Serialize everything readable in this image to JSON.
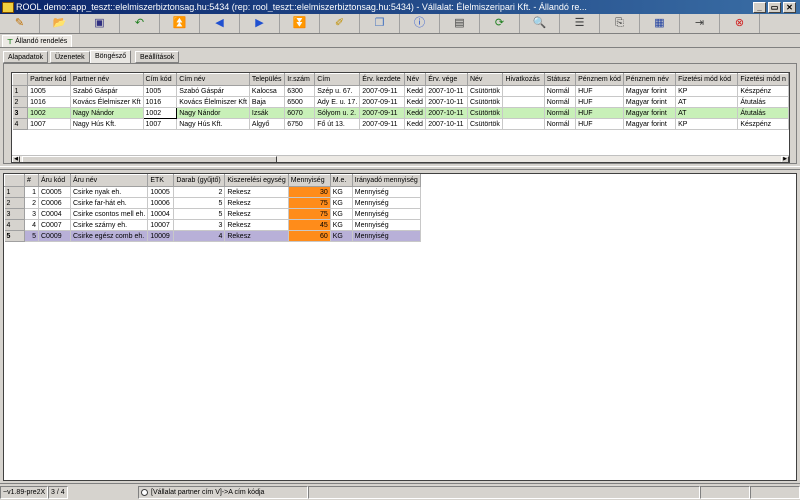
{
  "window": {
    "title": "ROOL demo::app_teszt::elelmiszerbiztonsag.hu:5434 (rep: rool_teszt::elelmiszerbiztonsag.hu:5434) - Vállalat: Élelmiszeripari Kft. - Állandó re...",
    "minimize": "_",
    "restore": "▭",
    "close": "✕"
  },
  "toolbar": [
    {
      "icon": "edit-icon",
      "glyph": "✎",
      "color": "#c07000"
    },
    {
      "icon": "open-icon",
      "glyph": "📂",
      "color": "#3060c0"
    },
    {
      "icon": "save-icon",
      "glyph": "▣",
      "color": "#303080"
    },
    {
      "icon": "undo-icon",
      "glyph": "↶",
      "color": "#208020"
    },
    {
      "icon": "first-icon",
      "glyph": "⏫",
      "color": "#2050d0"
    },
    {
      "icon": "prev-icon",
      "glyph": "◀",
      "color": "#2050d0"
    },
    {
      "icon": "next-icon",
      "glyph": "▶",
      "color": "#2050d0"
    },
    {
      "icon": "last-icon",
      "glyph": "⏬",
      "color": "#2050d0"
    },
    {
      "icon": "note-icon",
      "glyph": "✐",
      "color": "#c09000"
    },
    {
      "icon": "copy-icon",
      "glyph": "❐",
      "color": "#4070c0"
    },
    {
      "icon": "info-icon",
      "glyph": "ⓘ",
      "color": "#2050d0"
    },
    {
      "icon": "window-icon",
      "glyph": "▤",
      "color": "#404040"
    },
    {
      "icon": "refresh-icon",
      "glyph": "⟳",
      "color": "#208020"
    },
    {
      "icon": "search-icon",
      "glyph": "🔍",
      "color": "#404040"
    },
    {
      "icon": "layout-icon",
      "glyph": "☰",
      "color": "#404040"
    },
    {
      "icon": "export-icon",
      "glyph": "⎘",
      "color": "#404040"
    },
    {
      "icon": "grid-icon",
      "glyph": "▦",
      "color": "#2040a0"
    },
    {
      "icon": "exit-icon",
      "glyph": "⇥",
      "color": "#404040"
    },
    {
      "icon": "stop-icon",
      "glyph": "⊗",
      "color": "#d02020"
    }
  ],
  "window_tab": {
    "label": "Állandó rendelés"
  },
  "tabs": [
    {
      "label": "Alapadatok"
    },
    {
      "label": "Üzenetek"
    },
    {
      "label": "Böngésző"
    },
    {
      "label": "Beállítások"
    }
  ],
  "partner_grid": {
    "columns": [
      "",
      "Partner kód",
      "Partner név",
      "Cím kód",
      "Cím név",
      "Település",
      "Ir.szám",
      "Cím",
      "Érv. kezdete",
      "Név",
      "Érv. vége",
      "Név",
      "Hivatkozás",
      "Státusz",
      "Pénznem kód",
      "Pénznem név",
      "Fizetési mód kód",
      "Fizetési mód n"
    ],
    "rows": [
      [
        "1",
        "1005",
        "Szabó Gáspár",
        "1005",
        "Szabó Gáspár",
        "Kalocsa",
        "6300",
        "Szép u. 67.",
        "2007-09-11",
        "Kedd",
        "2007-10-11",
        "Csütörtök",
        "",
        "Normál",
        "HUF",
        "Magyar forint",
        "KP",
        "Készpénz"
      ],
      [
        "2",
        "1016",
        "Kovács Élelmiszer Kft",
        "1016",
        "Kovács Élelmiszer Kft",
        "Baja",
        "6500",
        "Ady E. u. 17.",
        "2007-09-11",
        "Kedd",
        "2007-10-11",
        "Csütörtök",
        "",
        "Normál",
        "HUF",
        "Magyar forint",
        "AT",
        "Átutalás"
      ],
      [
        "3",
        "1002",
        "Nagy Nándor",
        "1002",
        "Nagy Nándor",
        "Izsák",
        "6070",
        "Sólyom u. 2.",
        "2007-09-11",
        "Kedd",
        "2007-10-11",
        "Csütörtök",
        "",
        "Normál",
        "HUF",
        "Magyar forint",
        "AT",
        "Átutalás"
      ],
      [
        "4",
        "1007",
        "Nagy Hús Kft.",
        "1007",
        "Nagy Hús Kft.",
        "Algyő",
        "6750",
        "Fő út 13.",
        "2007-09-11",
        "Kedd",
        "2007-10-11",
        "Csütörtök",
        "",
        "Normál",
        "HUF",
        "Magyar forint",
        "KP",
        "Készpénz"
      ]
    ],
    "selected_row": 2
  },
  "items_grid": {
    "columns": [
      "",
      "#",
      "Áru kód",
      "Áru név",
      "ETK",
      "Darab (gyűjtő)",
      "Kiszerelési egység",
      "Mennyiség",
      "M.e.",
      "Irányadó mennyiség"
    ],
    "rows": [
      [
        "1",
        "1",
        "C0005",
        "Csirke nyak eh.",
        "10005",
        "2",
        "Rekesz",
        "30",
        "KG",
        "Mennyiség"
      ],
      [
        "2",
        "2",
        "C0006",
        "Csirke far-hát eh.",
        "10006",
        "5",
        "Rekesz",
        "75",
        "KG",
        "Mennyiség"
      ],
      [
        "3",
        "3",
        "C0004",
        "Csirke csontos mell eh.",
        "10004",
        "5",
        "Rekesz",
        "75",
        "KG",
        "Mennyiség"
      ],
      [
        "4",
        "4",
        "C0007",
        "Csirke szárny eh.",
        "10007",
        "3",
        "Rekesz",
        "45",
        "KG",
        "Mennyiség"
      ],
      [
        "5",
        "5",
        "C0009",
        "Csirke egész comb eh.",
        "10009",
        "4",
        "Rekesz",
        "60",
        "KG",
        "Mennyiség"
      ]
    ],
    "selected_row": 4,
    "highlight_color": "#ff8c1a"
  },
  "status": {
    "version": "~v1.89-pre2X",
    "position": "3 / 4",
    "hint": "[Vállalat partner cím V]->A cím kódja"
  }
}
